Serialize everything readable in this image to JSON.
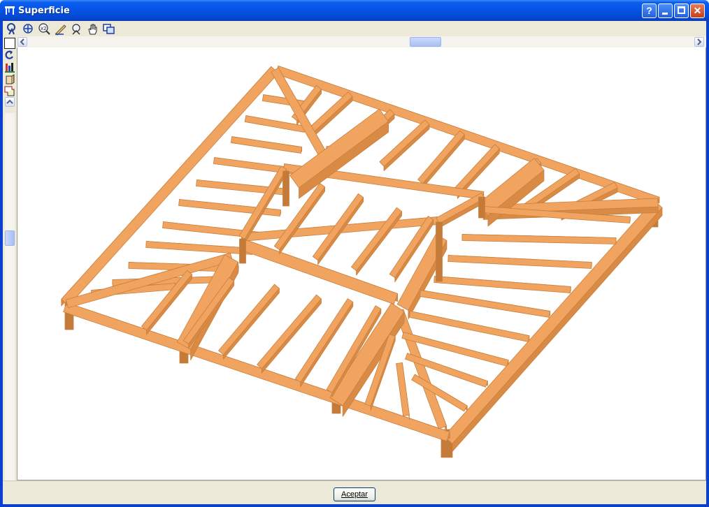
{
  "window": {
    "title": "Superficie",
    "help_glyph": "?",
    "close_glyph": "✕"
  },
  "toolbar": {
    "tools": [
      {
        "name": "select-zoom-icon"
      },
      {
        "name": "zoom-extents-icon"
      },
      {
        "name": "zoom-x2-icon"
      },
      {
        "name": "pencil-icon"
      },
      {
        "name": "zoom-window-icon"
      },
      {
        "name": "pan-hand-icon"
      },
      {
        "name": "copy-view-icon"
      }
    ]
  },
  "side_tools": [
    {
      "name": "rectangle-view-icon"
    },
    {
      "name": "rotate-icon"
    },
    {
      "name": "elevation-view-icon"
    },
    {
      "name": "side-view-icon"
    },
    {
      "name": "perspective-view-icon"
    }
  ],
  "footer": {
    "accept_label": "Aceptar"
  },
  "colors": {
    "wood": "#f0a460",
    "wood_dark": "#d98a44",
    "wood_shadow": "#c47a38"
  }
}
